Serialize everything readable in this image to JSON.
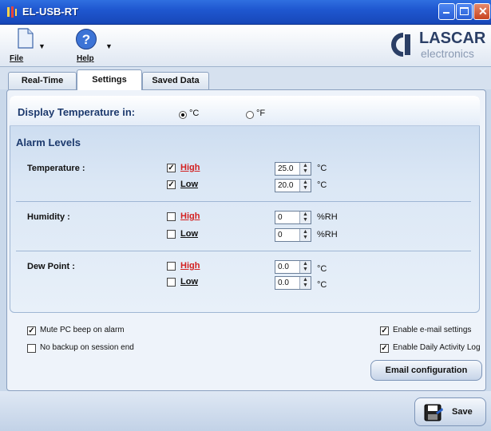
{
  "window": {
    "title": "EL-USB-RT",
    "icon": "thermometer-app-icon"
  },
  "toolbar": {
    "file_label": "File",
    "help_label": "Help",
    "logo_top": "LASCAR",
    "logo_bottom": "electronics"
  },
  "tabs": [
    {
      "label": "Real-Time",
      "active": false
    },
    {
      "label": "Settings",
      "active": true
    },
    {
      "label": "Saved Data",
      "active": false
    }
  ],
  "display": {
    "label": "Display Temperature in:",
    "options": [
      {
        "label": "°C",
        "selected": true
      },
      {
        "label": "°F",
        "selected": false
      }
    ]
  },
  "alarms": {
    "title": "Alarm Levels",
    "groups": [
      {
        "label": "Temperature :",
        "high_label": "High",
        "low_label": "Low",
        "high_checked": true,
        "low_checked": true,
        "high_value": "25.0",
        "low_value": "20.0",
        "unit": "°C"
      },
      {
        "label": "Humidity :",
        "high_label": "High",
        "low_label": "Low",
        "high_checked": false,
        "low_checked": false,
        "high_value": "0",
        "low_value": "0",
        "unit": "%RH"
      },
      {
        "label": "Dew Point :",
        "high_label": "High",
        "low_label": "Low",
        "high_checked": false,
        "low_checked": false,
        "high_value": "0.0",
        "low_value": "0.0",
        "unit": "°C"
      }
    ]
  },
  "options": {
    "mute_label": "Mute PC beep on alarm",
    "mute_checked": true,
    "nobackup_label": "No backup on session end",
    "nobackup_checked": false,
    "email_label": "Enable e-mail settings",
    "email_checked": true,
    "daily_label": "Enable Daily Activity Log",
    "daily_checked": true,
    "email_config_label": "Email configuration"
  },
  "footer": {
    "save_label": "Save"
  },
  "colors": {
    "high_red": "#d32020",
    "title_blue": "#1f57d0",
    "heading_navy": "#1d3a6e"
  }
}
